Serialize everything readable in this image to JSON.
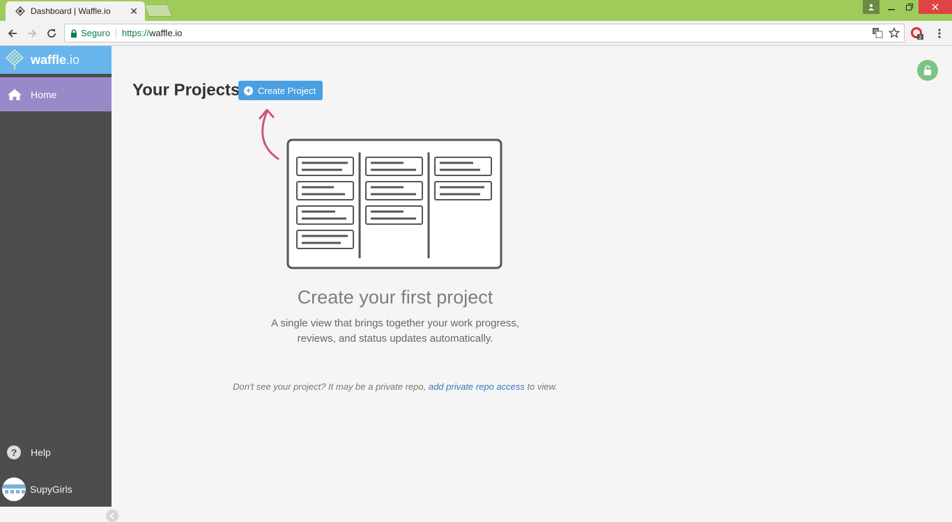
{
  "browser": {
    "tab_title": "Dashboard | Waffle.io",
    "tab_close": "✕",
    "security_label": "Seguro",
    "url_scheme": "https://",
    "url_host": "waffle.io",
    "ext_badge": "2"
  },
  "sidebar": {
    "brand": "waffle",
    "brand_suffix": ".io",
    "home_label": "Home",
    "help_label": "Help",
    "user_name": "SupyGirls"
  },
  "main": {
    "title": "Your Projects",
    "create_button": "Create Project",
    "empty_title": "Create your first project",
    "empty_desc": "A single view that brings together your work progress, reviews, and status updates automatically.",
    "note_prefix": "Don't see your project? It may be a private repo, ",
    "note_link": "add private repo access",
    "note_suffix": " to view."
  },
  "colors": {
    "titlebar": "#9fcb5a",
    "brand": "#67b5ec",
    "home_active": "#9a89c9",
    "sidebar": "#4d4d4d",
    "primary_button": "#4a9fe2",
    "arrow": "#d24f83",
    "lock_badge": "#7cc486"
  }
}
